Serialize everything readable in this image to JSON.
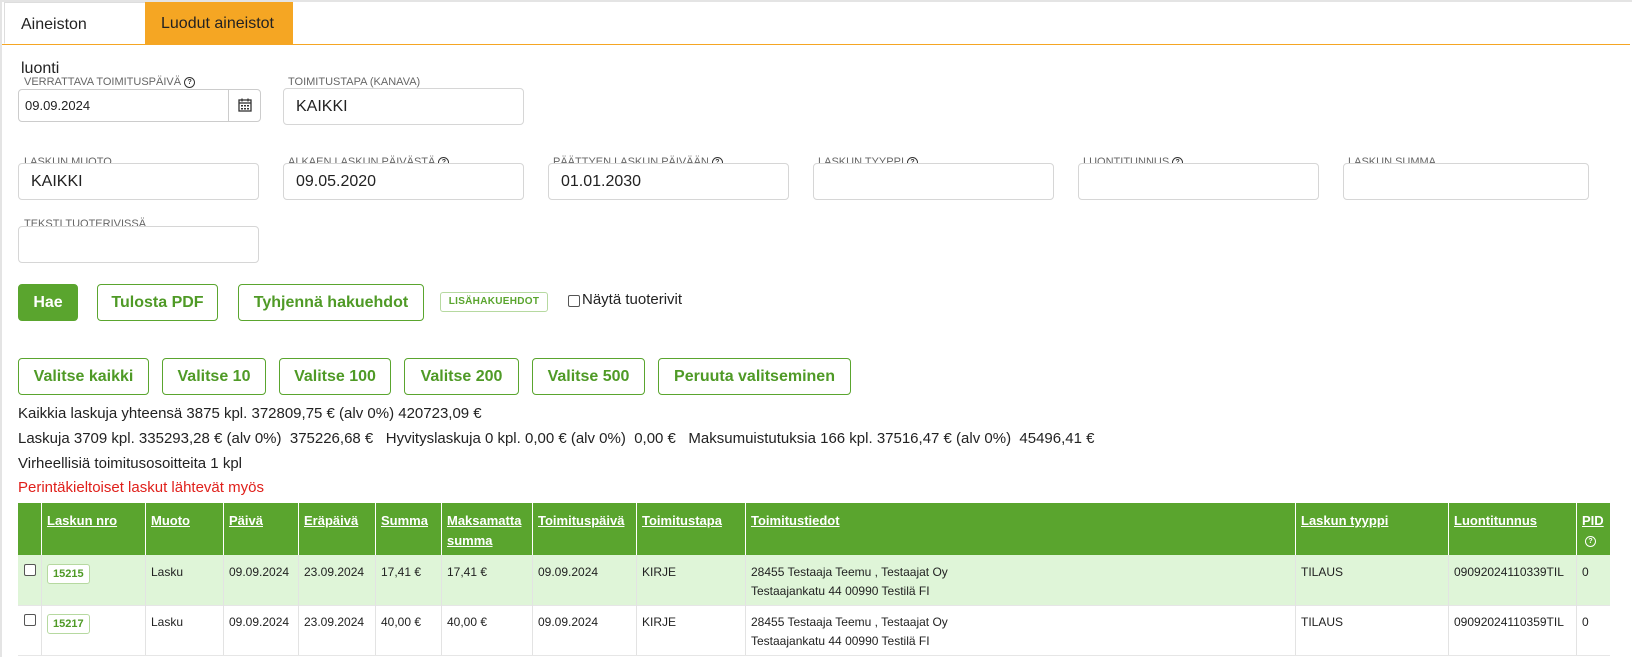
{
  "tabs": [
    {
      "label": "Aineiston luonti"
    },
    {
      "label": "Luodut aineistot"
    }
  ],
  "filters": {
    "compare_date": {
      "label": "VERRATTAVA TOIMITUSPÄIVÄ",
      "value": "09.09.2024"
    },
    "delivery_method": {
      "label": "TOIMITUSTAPA (KANAVA)",
      "value": "KAIKKI"
    },
    "invoice_form": {
      "label": "LASKUN MUOTO",
      "value": "KAIKKI"
    },
    "start_date": {
      "label": "ALKAEN LASKUN PÄIVÄSTÄ",
      "value": "09.05.2020"
    },
    "end_date": {
      "label": "PÄÄTTYEN LASKUN PÄIVÄÄN",
      "value": "01.01.2030"
    },
    "invoice_type": {
      "label": "LASKUN TYYPPI",
      "value": ""
    },
    "creation_id": {
      "label": "LUONTITUNNUS",
      "value": ""
    },
    "invoice_sum": {
      "label": "LASKUN SUMMA",
      "value": ""
    },
    "product_text": {
      "label": "TEKSTI TUOTERIVISSÄ",
      "value": ""
    }
  },
  "actions": {
    "search": "Hae",
    "print_pdf": "Tulosta PDF",
    "clear": "Tyhjennä hakuehdot",
    "more_filters": "LISÄHAKUEHDOT",
    "show_rows": "Näytä tuoterivit"
  },
  "select_buttons": [
    "Valitse kaikki",
    "Valitse 10",
    "Valitse 100",
    "Valitse 200",
    "Valitse 500",
    "Peruuta valitseminen"
  ],
  "summary": {
    "line1": "Kaikkia laskuja yhteensä 3875 kpl. 372809,75 € (alv 0%)  420723,09 €",
    "line2": "Laskuja 3709 kpl. 335293,28 € (alv 0%)  375226,68 €   Hyvityslaskuja 0 kpl. 0,00 € (alv 0%)  0,00 €   Maksumuistutuksia 166 kpl. 37516,47 € (alv 0%)  45496,41 €",
    "line3": "Virheellisiä toimitusosoitteita 1 kpl",
    "warning": "Perintäkieltoiset laskut lähtevät myös"
  },
  "table": {
    "headers": {
      "number": "Laskun nro",
      "form": "Muoto",
      "date": "Päivä",
      "due": "Eräpäivä",
      "sum": "Summa",
      "unpaid_1": "Maksamatta",
      "unpaid_2": "summa",
      "delivery_date": "Toimituspäivä",
      "delivery_method": "Toimitustapa",
      "delivery_info": "Toimitustiedot",
      "type": "Laskun tyyppi",
      "creation_id": "Luontitunnus",
      "pid": "PID"
    },
    "rows": [
      {
        "number": "15215",
        "form": "Lasku",
        "date": "09.09.2024",
        "due": "23.09.2024",
        "sum": "17,41 €",
        "unpaid": "17,41 €",
        "delivery_date": "09.09.2024",
        "delivery_method": "KIRJE",
        "info_1": "28455 Testaaja Teemu , Testaajat Oy",
        "info_2": "Testaajankatu 44 00990 Testilä FI",
        "type": "TILAUS",
        "creation_id": "09092024110339TIL",
        "pid": "0"
      },
      {
        "number": "15217",
        "form": "Lasku",
        "date": "09.09.2024",
        "due": "23.09.2024",
        "sum": "40,00 €",
        "unpaid": "40,00 €",
        "delivery_date": "09.09.2024",
        "delivery_method": "KIRJE",
        "info_1": "28455 Testaaja Teemu , Testaajat Oy",
        "info_2": "Testaajankatu 44 00990 Testilä FI",
        "type": "TILAUS",
        "creation_id": "09092024110359TIL",
        "pid": "0"
      }
    ]
  },
  "colors": {
    "accent": "#5aa52e",
    "tab_active": "#f5a623",
    "highlight_row": "#dff5d8",
    "warning": "#e0201b"
  },
  "icons": [
    "calendar-icon",
    "help-icon"
  ]
}
